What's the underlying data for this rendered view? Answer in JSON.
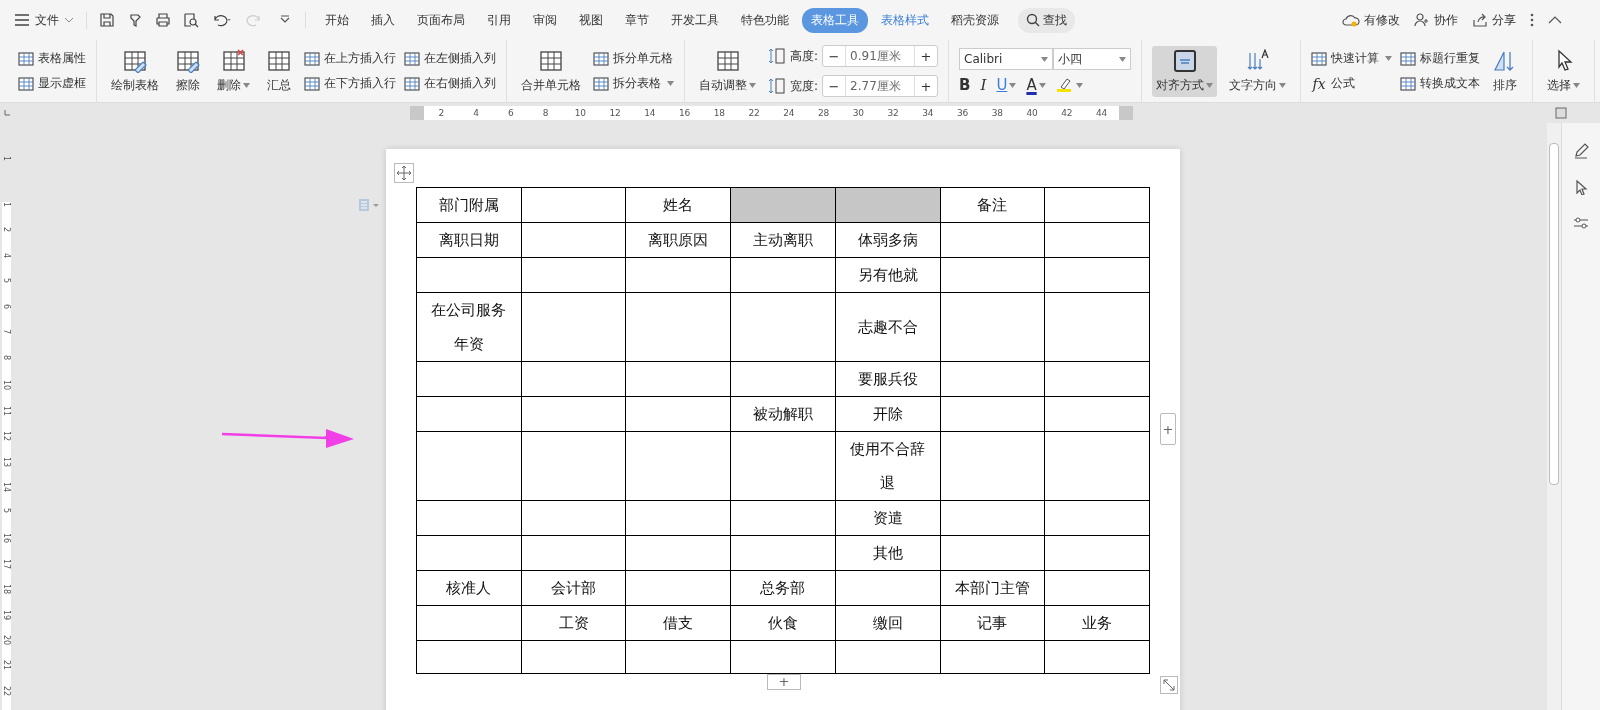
{
  "title_bar": {
    "file_menu": "文件",
    "tabs": [
      {
        "label": "开始",
        "selected": false,
        "kind": "normal"
      },
      {
        "label": "插入",
        "selected": false,
        "kind": "normal"
      },
      {
        "label": "页面布局",
        "selected": false,
        "kind": "normal"
      },
      {
        "label": "引用",
        "selected": false,
        "kind": "normal"
      },
      {
        "label": "审阅",
        "selected": false,
        "kind": "normal"
      },
      {
        "label": "视图",
        "selected": false,
        "kind": "normal"
      },
      {
        "label": "章节",
        "selected": false,
        "kind": "normal"
      },
      {
        "label": "开发工具",
        "selected": false,
        "kind": "normal"
      },
      {
        "label": "特色功能",
        "selected": false,
        "kind": "normal"
      },
      {
        "label": "表格工具",
        "selected": true,
        "kind": "contextual"
      },
      {
        "label": "表格样式",
        "selected": false,
        "kind": "contextual"
      },
      {
        "label": "稻壳资源",
        "selected": false,
        "kind": "normal"
      }
    ],
    "search": "查找",
    "actions": [
      {
        "kind": "cloud",
        "label": "有修改"
      },
      {
        "kind": "collab",
        "label": "协作"
      },
      {
        "kind": "share",
        "label": "分享"
      }
    ]
  },
  "ribbon": {
    "groups": [
      {
        "items": [
          {
            "kind": "pair",
            "items": [
              {
                "label": "表格属性",
                "dropdown": false
              },
              {
                "label": "显示虚框",
                "dropdown": false
              }
            ]
          }
        ]
      },
      {
        "items": [
          {
            "kind": "large",
            "label": "绘制表格",
            "dropdown": false,
            "pressed": false
          },
          {
            "kind": "large",
            "label": "擦除",
            "dropdown": false,
            "pressed": false
          },
          {
            "kind": "large",
            "label": "删除",
            "dropdown": true,
            "pressed": false
          },
          {
            "kind": "large",
            "label": "汇总",
            "dropdown": false,
            "pressed": false
          },
          {
            "kind": "pair",
            "items": [
              {
                "label": "在上方插入行",
                "dropdown": false
              },
              {
                "label": "在下方插入行",
                "dropdown": false
              }
            ]
          },
          {
            "kind": "pair",
            "items": [
              {
                "label": "在左侧插入列",
                "dropdown": false
              },
              {
                "label": "在右侧插入列",
                "dropdown": false
              }
            ]
          }
        ]
      },
      {
        "items": [
          {
            "kind": "large",
            "label": "合并单元格",
            "dropdown": false,
            "pressed": false
          },
          {
            "kind": "pair",
            "items": [
              {
                "label": "拆分单元格",
                "dropdown": false
              },
              {
                "label": "拆分表格",
                "dropdown": true
              }
            ]
          }
        ]
      },
      {
        "items": [
          {
            "kind": "large",
            "label": "自动调整",
            "dropdown": true,
            "pressed": false
          },
          {
            "kind": "spinners",
            "items": [
              {
                "label": "高度:",
                "value": "0.91厘米",
                "minus": "−",
                "plus": "+"
              },
              {
                "label": "宽度:",
                "value": "2.77厘米",
                "minus": "−",
                "plus": "+"
              }
            ]
          }
        ]
      },
      {
        "items": [
          {
            "kind": "font",
            "font": "Calibri",
            "size": "小四",
            "format": [
              {
                "kind": "bold",
                "glyph": "B",
                "dropdown": false
              },
              {
                "kind": "italic",
                "glyph": "I",
                "dropdown": false
              },
              {
                "kind": "underline",
                "glyph": "U",
                "dropdown": true
              },
              {
                "kind": "font_color",
                "glyph": "A",
                "dropdown": true
              },
              {
                "kind": "highlight",
                "dropdown": true
              }
            ]
          }
        ]
      },
      {
        "items": [
          {
            "kind": "large",
            "label": "对齐方式",
            "dropdown": true,
            "pressed": true
          },
          {
            "kind": "large",
            "label": "文字方向",
            "dropdown": true,
            "pressed": false
          }
        ]
      },
      {
        "items": [
          {
            "kind": "pair",
            "items": [
              {
                "label": "快速计算",
                "dropdown": true
              },
              {
                "label": "公式",
                "glyph": "fx",
                "dropdown": false
              }
            ]
          },
          {
            "kind": "pair",
            "items": [
              {
                "label": "标题行重复",
                "dropdown": false
              },
              {
                "label": "转换成文本",
                "dropdown": false
              }
            ]
          },
          {
            "kind": "large",
            "label": "排序",
            "dropdown": false,
            "pressed": false
          }
        ]
      },
      {
        "items": [
          {
            "kind": "large",
            "label": "选择",
            "dropdown": true,
            "pressed": false
          }
        ]
      }
    ]
  },
  "horizontal_ruler": {
    "labels": [
      "2",
      "4",
      "6",
      "8",
      "10",
      "12",
      "14",
      "16",
      "18",
      "22",
      "24",
      "28",
      "30",
      "32",
      "34",
      "36",
      "38",
      "40",
      "42",
      "44"
    ]
  },
  "vertical_ruler": {
    "labels": [
      "1",
      "2",
      "4",
      "5",
      "6",
      "7",
      "8",
      "10",
      "11",
      "12",
      "13",
      "14",
      "5",
      "16",
      "17",
      "18",
      "19",
      "20",
      "21",
      "22"
    ],
    "top_label": "1"
  },
  "table": {
    "add_row": "+",
    "add_column": "+",
    "rows": [
      {
        "cells": [
          {
            "text": "部门附属",
            "selected": false
          },
          {
            "selected": false
          },
          {
            "text": "姓名",
            "selected": false
          },
          {
            "selected": true
          },
          {
            "selected": true
          },
          {
            "text": "备注",
            "selected": false
          },
          {
            "selected": false
          }
        ]
      },
      {
        "cells": [
          {
            "text": "离职日期",
            "selected": false
          },
          {
            "selected": false
          },
          {
            "text": "离职原因",
            "selected": false
          },
          {
            "text": "主动离职",
            "selected": false
          },
          {
            "text": "体弱多病",
            "selected": false
          },
          {
            "selected": false
          },
          {
            "selected": false
          }
        ]
      },
      {
        "cells": [
          {
            "selected": false
          },
          {
            "selected": false
          },
          {
            "selected": false
          },
          {
            "selected": false
          },
          {
            "text": "另有他就",
            "selected": false
          },
          {
            "selected": false
          },
          {
            "selected": false
          }
        ]
      },
      {
        "cells": [
          {
            "text": "在公司服务年资",
            "selected": false
          },
          {
            "selected": false
          },
          {
            "selected": false
          },
          {
            "selected": false
          },
          {
            "text": "志趣不合",
            "selected": false
          },
          {
            "selected": false
          },
          {
            "selected": false
          }
        ]
      },
      {
        "cells": [
          {
            "selected": false
          },
          {
            "selected": false
          },
          {
            "selected": false
          },
          {
            "selected": false
          },
          {
            "text": "要服兵役",
            "selected": false
          },
          {
            "selected": false
          },
          {
            "selected": false
          }
        ]
      },
      {
        "cells": [
          {
            "selected": false
          },
          {
            "selected": false
          },
          {
            "selected": false
          },
          {
            "text": "被动解职",
            "selected": false
          },
          {
            "text": "开除",
            "selected": false
          },
          {
            "selected": false
          },
          {
            "selected": false
          }
        ]
      },
      {
        "cells": [
          {
            "selected": false
          },
          {
            "selected": false
          },
          {
            "selected": false
          },
          {
            "selected": false
          },
          {
            "text": "使用不合辞退",
            "selected": false
          },
          {
            "selected": false
          },
          {
            "selected": false
          }
        ]
      },
      {
        "cells": [
          {
            "selected": false
          },
          {
            "selected": false
          },
          {
            "selected": false
          },
          {
            "selected": false
          },
          {
            "text": "资遣",
            "selected": false
          },
          {
            "selected": false
          },
          {
            "selected": false
          }
        ]
      },
      {
        "cells": [
          {
            "selected": false
          },
          {
            "selected": false
          },
          {
            "selected": false
          },
          {
            "selected": false
          },
          {
            "text": "其他",
            "selected": false
          },
          {
            "selected": false
          },
          {
            "selected": false
          }
        ]
      },
      {
        "cells": [
          {
            "text": "核准人",
            "selected": false
          },
          {
            "text": "会计部",
            "selected": false
          },
          {
            "selected": false
          },
          {
            "text": "总务部",
            "selected": false
          },
          {
            "selected": false
          },
          {
            "text": "本部门主管",
            "selected": false
          },
          {
            "selected": false
          }
        ]
      },
      {
        "cells": [
          {
            "selected": false
          },
          {
            "text": "工资",
            "selected": false
          },
          {
            "text": "借支",
            "selected": false
          },
          {
            "text": "伙食",
            "selected": false
          },
          {
            "text": "缴回",
            "selected": false
          },
          {
            "text": "记事",
            "selected": false
          },
          {
            "text": "业务",
            "selected": false
          }
        ]
      },
      {
        "cells": [
          {
            "selected": false
          },
          {
            "selected": false
          },
          {
            "selected": false
          },
          {
            "selected": false
          },
          {
            "selected": false
          },
          {
            "selected": false
          },
          {
            "selected": false
          }
        ]
      }
    ]
  }
}
